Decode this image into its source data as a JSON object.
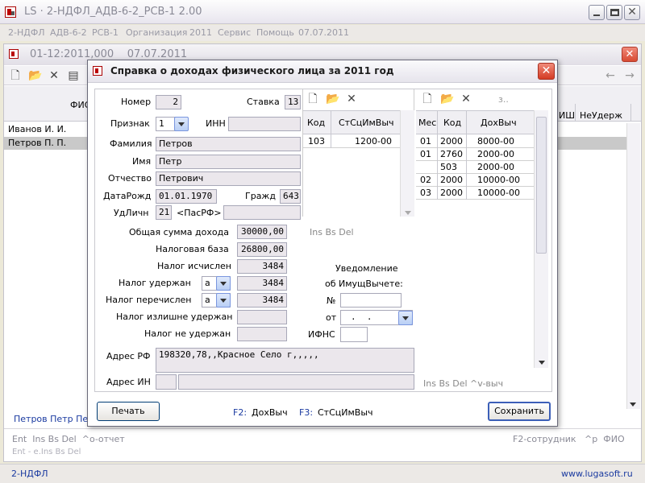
{
  "app": {
    "title": "LS · 2-НДФЛ_АДВ-6-2_РСВ-1  2.00",
    "menu": [
      "2-НДФЛ",
      "АДВ-6-2",
      "РСВ-1",
      "Организация",
      "2011",
      "Сервис",
      "Помощь",
      "07.07.2011"
    ]
  },
  "inner": {
    "title": "01-12:2011,000    07.07.2011",
    "columns": {
      "fio": "ФИО",
      "ish": "ИШ",
      "neuderzh": "НеУдерж"
    },
    "rows": [
      {
        "name": "Иванов И. И."
      },
      {
        "name": "Петров П. П."
      }
    ],
    "status_fio": "Петров Петр Пе",
    "hint_left": "Ent  Ins Bs Del  ^o-отчет",
    "hint_left2": "Ent - e.Ins Bs Del",
    "hint_right": "F2-сотрудник   ^p  ФИО"
  },
  "footer": {
    "left": "2-НДФЛ",
    "right": "www.lugasoft.ru"
  },
  "dialog": {
    "title": "Справка о доходах физического лица за 2011 год",
    "labels": {
      "nomer": "Номер",
      "stavka": "Ставка",
      "priznak": "Признак",
      "inn": "ИНН",
      "familia": "Фамилия",
      "imya": "Имя",
      "otchestvo": "Отчество",
      "datarozh": "ДатаРожд",
      "grazhd": "Гражд",
      "udlichn": "УдЛичн",
      "obshaya": "Общая сумма дохода",
      "nalbaza": "Налоговая база",
      "nalisch": "Налог исчислен",
      "naluder": "Налог удержан",
      "nalperech": "Налог перечислен",
      "nalizl": "Налог излишне удержан",
      "nalne": "Налог не удержан",
      "uvedom1": "Уведомление",
      "uvedom2": "об ИмущВычете:",
      "nomer2": "№",
      "ot": "от",
      "ifns": "ИФНС",
      "adresrf": "Адрес РФ",
      "adresin": "Адрес ИН"
    },
    "values": {
      "nomer": "2",
      "stavka": "13",
      "priznak": "1",
      "familia": "Петров",
      "imya": "Петр",
      "otchestvo": "Петрович",
      "datarozh": "01.01.1970",
      "grazhd": "643",
      "udlichn": "21",
      "udlichn_name": "<ПасРФ>",
      "obshaya": "30000,00",
      "nalbaza": "26800,00",
      "nalisch": "3484",
      "naluder": "3484",
      "naluder_sel": "а",
      "nalperech": "3484",
      "nalperech_sel": "а",
      "ot_date": ".  .",
      "adresrf": "198320,78,,Красное Село г,,,,,"
    },
    "hint_ins": "Ins Bs Del",
    "hint_ins2": "Ins Bs Del  ^v-выч",
    "scodes": {
      "headers": [
        "Код",
        "СтСцИмВыч"
      ],
      "rows": [
        [
          "103",
          "1200-00"
        ]
      ]
    },
    "incomes": {
      "headers": [
        "Мес",
        "Код",
        "ДохВыч"
      ],
      "rows": [
        [
          "01",
          "2000",
          "8000-00"
        ],
        [
          "01",
          "2760",
          "2000-00"
        ],
        [
          "",
          "503",
          "2000-00"
        ],
        [
          "02",
          "2000",
          "10000-00"
        ],
        [
          "03",
          "2000",
          "10000-00"
        ]
      ]
    },
    "buttons": {
      "print": "Печать",
      "save": "Сохранить"
    },
    "fkeys": {
      "f2": "F2:",
      "f2_label": "ДохВыч",
      "f3": "F3:",
      "f3_label": "СтСцИмВыч"
    }
  }
}
